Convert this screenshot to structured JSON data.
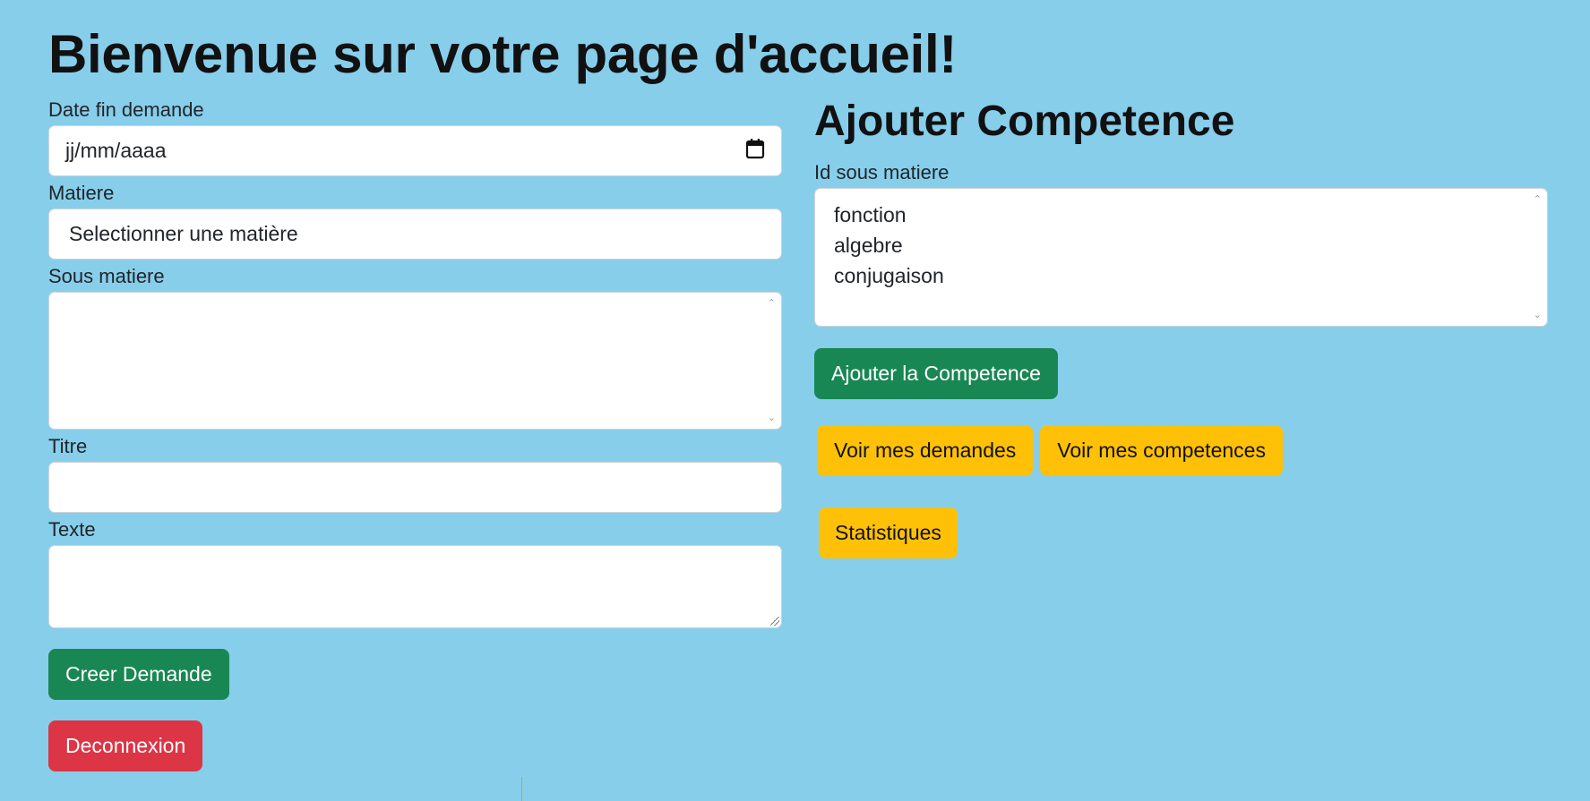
{
  "page": {
    "title": "Bienvenue sur votre page d'accueil!"
  },
  "demand_form": {
    "date_label": "Date fin demande",
    "date_placeholder": "jj/mm/aaaa",
    "matiere_label": "Matiere",
    "matiere_selected": "Selectionner une matière",
    "sous_matiere_label": "Sous matiere",
    "titre_label": "Titre",
    "titre_value": "",
    "texte_label": "Texte",
    "texte_value": "",
    "submit_label": "Creer Demande"
  },
  "logout": {
    "label": "Deconnexion"
  },
  "competence_form": {
    "title": "Ajouter Competence",
    "id_label": "Id sous matiere",
    "options": [
      "fonction",
      "algebre",
      "conjugaison"
    ],
    "submit_label": "Ajouter la Competence"
  },
  "nav_buttons": {
    "demandes": "Voir mes demandes",
    "competences": "Voir mes competences",
    "statistiques": "Statistiques"
  },
  "colors": {
    "background": "#87ceeb",
    "success": "#198754",
    "danger": "#dc3545",
    "warning": "#ffc107"
  },
  "icons": {
    "date_picker": "calendar-icon"
  }
}
